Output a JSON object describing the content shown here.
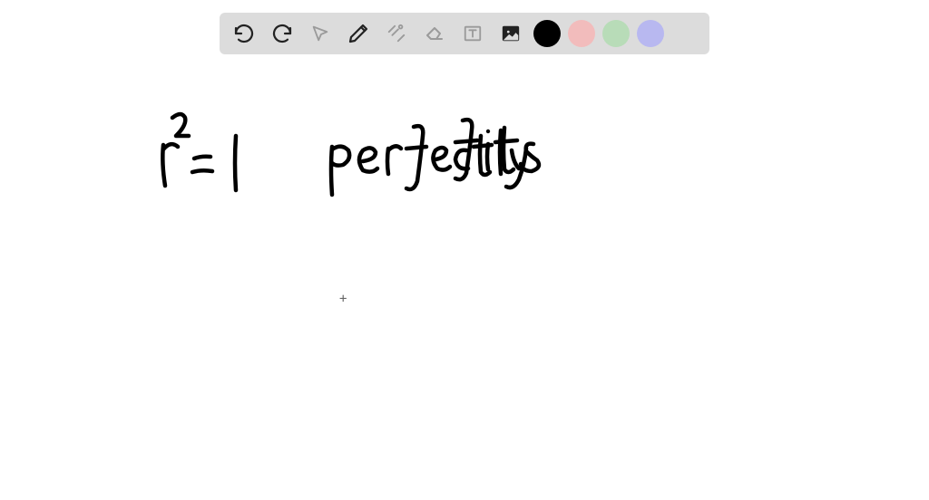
{
  "toolbar": {
    "tools": [
      {
        "name": "undo",
        "enabled": true
      },
      {
        "name": "redo",
        "enabled": true
      },
      {
        "name": "pointer",
        "enabled": false
      },
      {
        "name": "pencil",
        "enabled": true
      },
      {
        "name": "tools",
        "enabled": false
      },
      {
        "name": "eraser",
        "enabled": false
      },
      {
        "name": "text",
        "enabled": false
      },
      {
        "name": "image",
        "enabled": true
      }
    ],
    "colors": [
      {
        "name": "black",
        "hex": "#000000",
        "selected": true
      },
      {
        "name": "pink",
        "hex": "#f2bcbc",
        "selected": false
      },
      {
        "name": "green",
        "hex": "#b8dcb8",
        "selected": false
      },
      {
        "name": "purple",
        "hex": "#b8b8f0",
        "selected": false
      }
    ]
  },
  "handwriting": {
    "equation": "r² = 1",
    "note": "perfectly fits"
  },
  "cursor": {
    "symbol": "+"
  }
}
